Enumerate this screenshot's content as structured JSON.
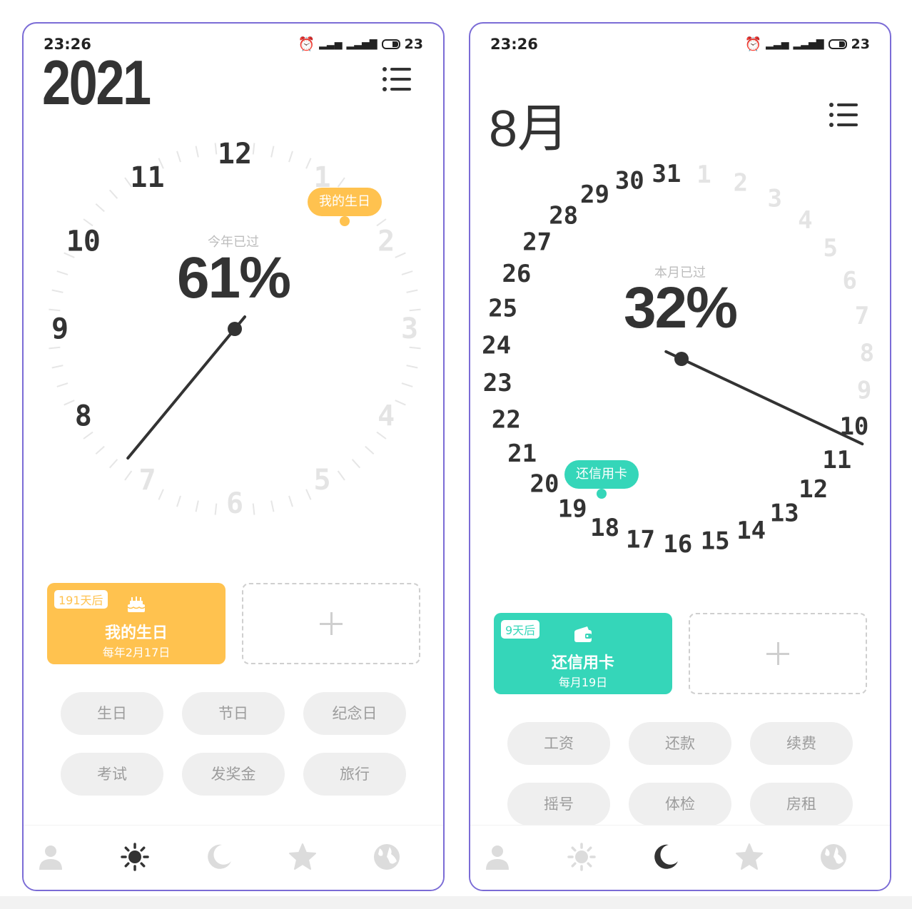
{
  "status": {
    "time": "23:26",
    "net1": "4G",
    "net2": "4G",
    "battery": "23"
  },
  "colors": {
    "accent_year": "#ffc24f",
    "accent_month": "#35d6b9",
    "dark": "#333333",
    "faint": "#e4e4e4",
    "chip_bg": "#efefef"
  },
  "screen_year": {
    "title": "2021",
    "menu_icon": "list-icon",
    "dial": {
      "labels": [
        "1",
        "2",
        "3",
        "4",
        "5",
        "6",
        "7",
        "8",
        "9",
        "10",
        "11",
        "12"
      ],
      "passed": [
        "8",
        "9",
        "10",
        "11",
        "12"
      ],
      "progress_label": "今年已过",
      "progress_value": "61%",
      "progress_fraction": 0.61
    },
    "marker": {
      "label": "我的生日"
    },
    "event_card": {
      "badge": "191天后",
      "name": "我的生日",
      "sub": "每年2月17日",
      "icon": "cake-icon"
    },
    "chips": [
      "生日",
      "节日",
      "纪念日",
      "考试",
      "发奖金",
      "旅行"
    ]
  },
  "screen_month": {
    "title": "8月",
    "menu_icon": "list-icon",
    "dial": {
      "labels": [
        "1",
        "2",
        "3",
        "4",
        "5",
        "6",
        "7",
        "8",
        "9",
        "10",
        "11",
        "12",
        "13",
        "14",
        "15",
        "16",
        "17",
        "18",
        "19",
        "20",
        "21",
        "22",
        "23",
        "24",
        "25",
        "26",
        "27",
        "28",
        "29",
        "30",
        "31"
      ],
      "passed_from": 10,
      "progress_label": "本月已过",
      "progress_value": "32%",
      "progress_fraction": 0.32
    },
    "marker": {
      "label": "还信用卡"
    },
    "event_card": {
      "badge": "9天后",
      "name": "还信用卡",
      "sub": "每月19日",
      "icon": "wallet-icon"
    },
    "chips": [
      "工资",
      "还款",
      "续费",
      "摇号",
      "体检",
      "房租"
    ]
  },
  "tabs": [
    {
      "icon": "person-icon"
    },
    {
      "icon": "sun-icon"
    },
    {
      "icon": "moon-icon"
    },
    {
      "icon": "star-icon"
    },
    {
      "icon": "globe-icon"
    }
  ],
  "active_tab": {
    "screen_year": 1,
    "screen_month": 2
  }
}
